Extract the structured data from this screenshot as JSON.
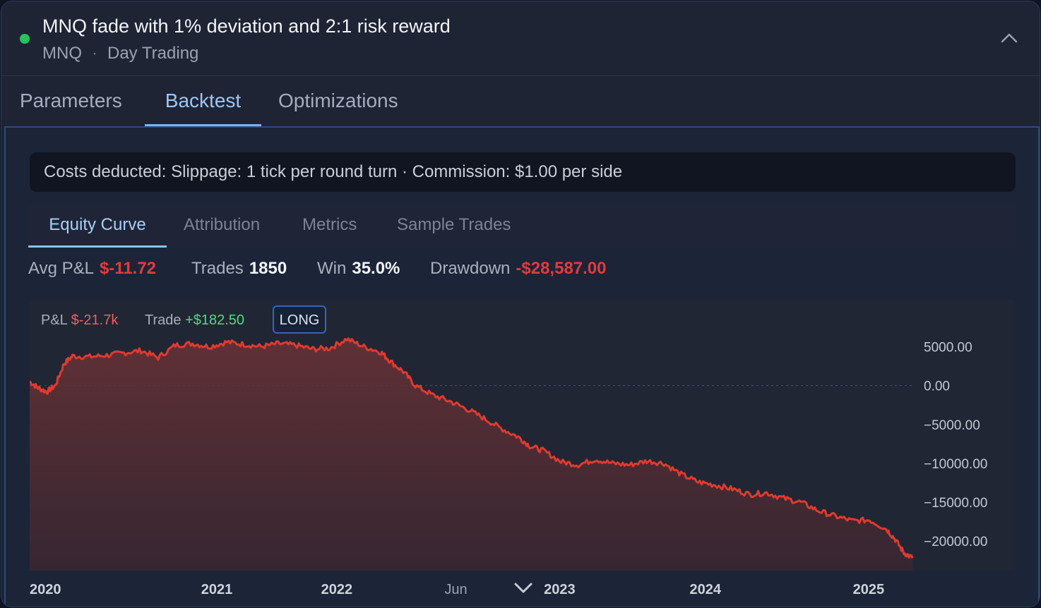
{
  "header": {
    "title": "MNQ fade with 1% deviation and 2:1 risk reward",
    "symbol": "MNQ",
    "separator": "·",
    "style": "Day Trading",
    "status_color": "#22c55e"
  },
  "tabs": [
    {
      "label": "Parameters"
    },
    {
      "label": "Backtest"
    },
    {
      "label": "Optimizations"
    }
  ],
  "costs_text": "Costs deducted: Slippage: 1 tick per round turn · Commission: $1.00 per side",
  "subtabs": [
    {
      "label": "Equity Curve"
    },
    {
      "label": "Attribution"
    },
    {
      "label": "Metrics"
    },
    {
      "label": "Sample Trades"
    }
  ],
  "stats": {
    "avg_pl_label": "Avg P&L",
    "avg_pl_value": "$-11.72",
    "trades_label": "Trades",
    "trades_value": "1850",
    "win_label": "Win",
    "win_value": "35.0%",
    "drawdown_label": "Drawdown",
    "drawdown_value": "-$28,587.00"
  },
  "chart_legend": {
    "pl_label": "P&L",
    "pl_value": "$-21.7k",
    "trade_label": "Trade",
    "trade_value": "+$182.50",
    "side_badge": "LONG"
  },
  "chart_data": {
    "type": "area",
    "ytick_labels": [
      "5000.00",
      "0.00",
      "−5000.00",
      "−10000.00",
      "−15000.00",
      "−20000.00"
    ],
    "yticks": [
      5000,
      0,
      -5000,
      -10000,
      -15000,
      -20000
    ],
    "ylim": [
      -23800,
      6500
    ],
    "xlim": [
      2020.0,
      2025.15
    ],
    "xtick_labels": [
      "2020",
      "2021",
      "2022",
      "Jun",
      "2023",
      "2024",
      "2025"
    ],
    "xticks": [
      2020.0,
      2021.0,
      2021.7,
      2022.42,
      2023.0,
      2023.85,
      2025.0
    ],
    "line_color": "#e03a2f",
    "x": [
      2020.0,
      2020.05,
      2020.1,
      2020.15,
      2020.2,
      2020.25,
      2020.35,
      2020.45,
      2020.55,
      2020.65,
      2020.75,
      2020.85,
      2020.95,
      2021.05,
      2021.15,
      2021.25,
      2021.35,
      2021.45,
      2021.55,
      2021.65,
      2021.75,
      2021.85,
      2021.95,
      2022.05,
      2022.1,
      2022.18,
      2022.25,
      2022.35,
      2022.45,
      2022.55,
      2022.65,
      2022.75,
      2022.85,
      2022.92,
      2023.0,
      2023.1,
      2023.2,
      2023.3,
      2023.4,
      2023.5,
      2023.6,
      2023.7,
      2023.8,
      2023.9,
      2024.0,
      2024.1,
      2024.2,
      2024.3,
      2024.4,
      2024.5,
      2024.6,
      2024.7,
      2024.8,
      2024.9,
      2025.0,
      2025.05,
      2025.1,
      2025.15
    ],
    "values": [
      500,
      -300,
      -800,
      0,
      2800,
      3800,
      3700,
      3900,
      4200,
      4500,
      3600,
      5200,
      5400,
      5000,
      5600,
      5300,
      5000,
      5400,
      5200,
      4700,
      4800,
      6000,
      5000,
      4300,
      3200,
      1800,
      0,
      -1200,
      -2000,
      -3000,
      -4200,
      -5500,
      -6600,
      -7800,
      -8400,
      -9800,
      -10200,
      -9500,
      -10000,
      -10200,
      -9700,
      -10000,
      -11400,
      -12400,
      -12800,
      -13300,
      -14000,
      -13800,
      -14500,
      -15000,
      -16100,
      -16800,
      -17400,
      -17300,
      -18500,
      -19800,
      -21500,
      -22200
    ]
  }
}
